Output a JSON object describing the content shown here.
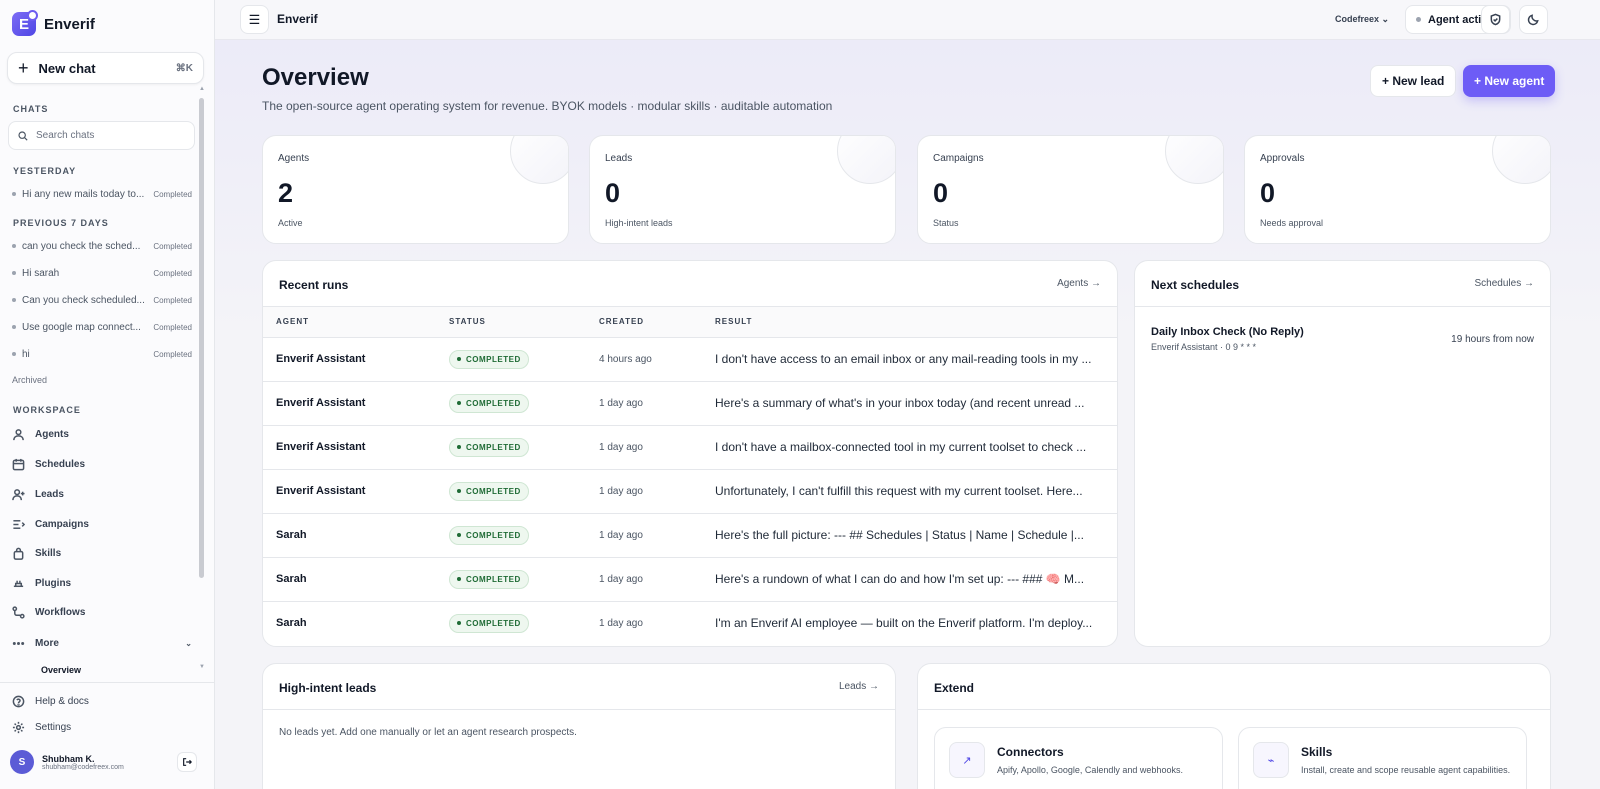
{
  "brand": {
    "name": "Enverif",
    "logo_letter": "E"
  },
  "sidebar": {
    "new_chat": {
      "label": "New chat",
      "shortcut": "⌘K"
    },
    "chats_label": "CHATS",
    "search_placeholder": "Search chats",
    "groups": [
      {
        "label": "YESTERDAY",
        "items": [
          {
            "title": "Hi any new mails today to...",
            "status": "Completed"
          }
        ]
      },
      {
        "label": "PREVIOUS 7 DAYS",
        "items": [
          {
            "title": "can you check the sched...",
            "status": "Completed"
          },
          {
            "title": "Hi sarah",
            "status": "Completed"
          },
          {
            "title": "Can you check scheduled...",
            "status": "Completed"
          },
          {
            "title": "Use google map connect...",
            "status": "Completed"
          },
          {
            "title": "hi",
            "status": "Completed"
          }
        ]
      }
    ],
    "archived": "Archived",
    "workspace_label": "WORKSPACE",
    "nav": [
      {
        "label": "Agents",
        "icon": "person-icon"
      },
      {
        "label": "Schedules",
        "icon": "calendar-icon"
      },
      {
        "label": "Leads",
        "icon": "user-plus-icon"
      },
      {
        "label": "Campaigns",
        "icon": "list-icon"
      },
      {
        "label": "Skills",
        "icon": "bag-icon"
      },
      {
        "label": "Plugins",
        "icon": "plug-icon"
      },
      {
        "label": "Workflows",
        "icon": "flow-icon"
      },
      {
        "label": "More",
        "icon": "dots-icon"
      }
    ],
    "more_sub": "Overview",
    "footer": [
      {
        "label": "Help & docs",
        "icon": "help-icon"
      },
      {
        "label": "Settings",
        "icon": "gear-icon"
      }
    ],
    "user": {
      "initial": "S",
      "name": "Shubham K.",
      "email": "shubham@codefreex.com"
    }
  },
  "topbar": {
    "title": "Enverif",
    "workspace": "Codefreex",
    "agent_activity": "Agent activity"
  },
  "header": {
    "title": "Overview",
    "subtitle": "The open-source agent operating system for revenue. BYOK models · modular skills · auditable automation",
    "new_lead": "+ New lead",
    "new_agent": "+ New agent"
  },
  "stats": [
    {
      "label": "Agents",
      "value": "2",
      "sub": "Active"
    },
    {
      "label": "Leads",
      "value": "0",
      "sub": "High-intent leads"
    },
    {
      "label": "Campaigns",
      "value": "0",
      "sub": "Status"
    },
    {
      "label": "Approvals",
      "value": "0",
      "sub": "Needs approval"
    }
  ],
  "recent_runs": {
    "title": "Recent runs",
    "link": "Agents →",
    "columns": [
      "AGENT",
      "STATUS",
      "CREATED",
      "RESULT"
    ],
    "rows": [
      {
        "agent": "Enverif Assistant",
        "status": "COMPLETED",
        "created": "4 hours ago",
        "result": "I don't have access to an email inbox or any mail-reading tools in my ..."
      },
      {
        "agent": "Enverif Assistant",
        "status": "COMPLETED",
        "created": "1 day ago",
        "result": "Here's a summary of what's in your inbox today (and recent unread ..."
      },
      {
        "agent": "Enverif Assistant",
        "status": "COMPLETED",
        "created": "1 day ago",
        "result": "I don't have a mailbox-connected tool in my current toolset to check ..."
      },
      {
        "agent": "Enverif Assistant",
        "status": "COMPLETED",
        "created": "1 day ago",
        "result": "Unfortunately, I can't fulfill this request with my current toolset. Here..."
      },
      {
        "agent": "Sarah",
        "status": "COMPLETED",
        "created": "1 day ago",
        "result": "Here's the full picture: --- ## Schedules | Status | Name | Schedule |..."
      },
      {
        "agent": "Sarah",
        "status": "COMPLETED",
        "created": "1 day ago",
        "result": "Here's a rundown of what I can do and how I'm set up: --- ### 🧠 M..."
      },
      {
        "agent": "Sarah",
        "status": "COMPLETED",
        "created": "1 day ago",
        "result": "I'm an Enverif AI employee — built on the Enverif platform. I'm deploy..."
      }
    ]
  },
  "next_schedules": {
    "title": "Next schedules",
    "link": "Schedules →",
    "items": [
      {
        "name": "Daily Inbox Check (No Reply)",
        "meta": "Enverif Assistant · 0 9 * * *",
        "when": "19 hours from now"
      }
    ]
  },
  "leads": {
    "title": "High-intent leads",
    "link": "Leads →",
    "empty": "No leads yet. Add one manually or let an agent research prospects."
  },
  "extend": {
    "title": "Extend",
    "items": [
      {
        "title": "Connectors",
        "desc": "Apify, Apollo, Google, Calendly and webhooks.",
        "icon": "arrow-up-right-icon"
      },
      {
        "title": "Skills",
        "desc": "Install, create and scope reusable agent capabilities.",
        "icon": "sparkle-icon"
      }
    ]
  },
  "colors": {
    "accent": "#6d5cf6",
    "success": "#1f6b35"
  }
}
